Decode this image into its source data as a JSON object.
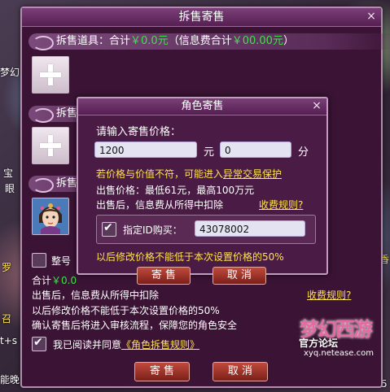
{
  "main_window": {
    "title": "拆售寄售",
    "close_label": "×",
    "items_section": {
      "label": "拆售道具：",
      "total_prefix": "合计",
      "total_value": "￥0.0元",
      "fee_open": "（信息费合计",
      "fee_value": "￥00.00元",
      "fee_close": "）"
    },
    "section2_label": "拆售",
    "section3_label": "拆售",
    "bottom": {
      "checkbox_label": "整号",
      "total_prefix": "合计",
      "total_value": "￥0.0",
      "line_fee": "出售后，信息费从所得中扣除",
      "fee_rule_link": "收费规则?",
      "line_modify": "以后修改价格不能低于本次设置价格的50%",
      "line_review": "确认寄售后将进入审核流程，保障您的角色安全",
      "agree_prefix": "我已阅读并同意",
      "agree_link": "《角色拆售规则》"
    },
    "consign_button": "寄 售",
    "cancel_button": "取 消"
  },
  "inner_dialog": {
    "title": "角色寄售",
    "close_label": "×",
    "prompt": "请输入寄售价格：",
    "yuan_value": "1200",
    "yuan_unit": "元",
    "fen_value": "0",
    "fen_unit": "分",
    "warn_prefix": "若价格与价值不符，可能进入",
    "warn_link": "异常交易保护",
    "price_range": "出售价格：最低61元，最高100万元",
    "fee_note": "出售后，信息费从所得中扣除",
    "fee_rule_link": "收费规则?",
    "designated_id_label": "指定ID购买：",
    "designated_id_value": "43078002",
    "modify_note": "以后修改价格不能低于本次设置价格的50%",
    "consign_button": "寄 售",
    "cancel_button": "取 消"
  },
  "background_fragments": {
    "left_top": "梦幻",
    "left_mid": "宝",
    "left_mid2": "眼",
    "left_low": "罗",
    "left_low2": "召",
    "left_low3": "t+s",
    "left_bottom": "能晚",
    "right_low": "香",
    "right_edge": "5"
  },
  "logo": {
    "main": "梦幻西游",
    "sub": "官方论坛",
    "url": "xyq.netease.com"
  },
  "colors": {
    "accent_green": "#3fe04a",
    "link_yellow": "#ffe34a",
    "button_red": "#a3362c"
  }
}
